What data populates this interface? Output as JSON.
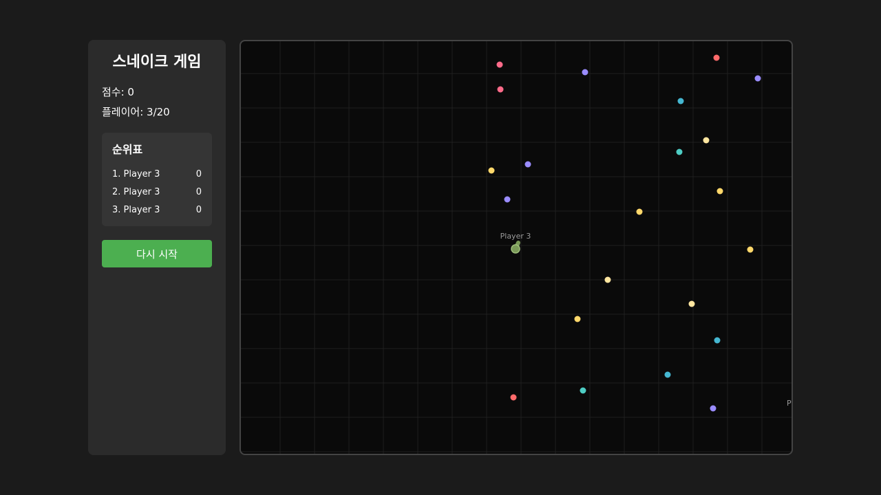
{
  "game": {
    "title": "스네이크 게임",
    "score_text": "점수: 0",
    "players_text": "플레이어: 3/20"
  },
  "leaderboard": {
    "title": "순위표",
    "rows": [
      {
        "name": "1. Player 3",
        "score": "0"
      },
      {
        "name": "2. Player 3",
        "score": "0"
      },
      {
        "name": "3. Player 3",
        "score": "0"
      }
    ]
  },
  "controls": {
    "restart_label": "다시 시작"
  },
  "board": {
    "player_label": "Player 3",
    "offscreen_label": "P",
    "snake_color": "#7a9a58",
    "grid_color": "#1f1f1f",
    "food_colors": {
      "pink": "#ff6b8a",
      "red": "#ff6b6b",
      "purple": "#9a8cff",
      "teal": "#4ecdc4",
      "cyan": "#45b7d1",
      "yellow": "#ffd86b",
      "cream": "#ffe6a0"
    }
  }
}
